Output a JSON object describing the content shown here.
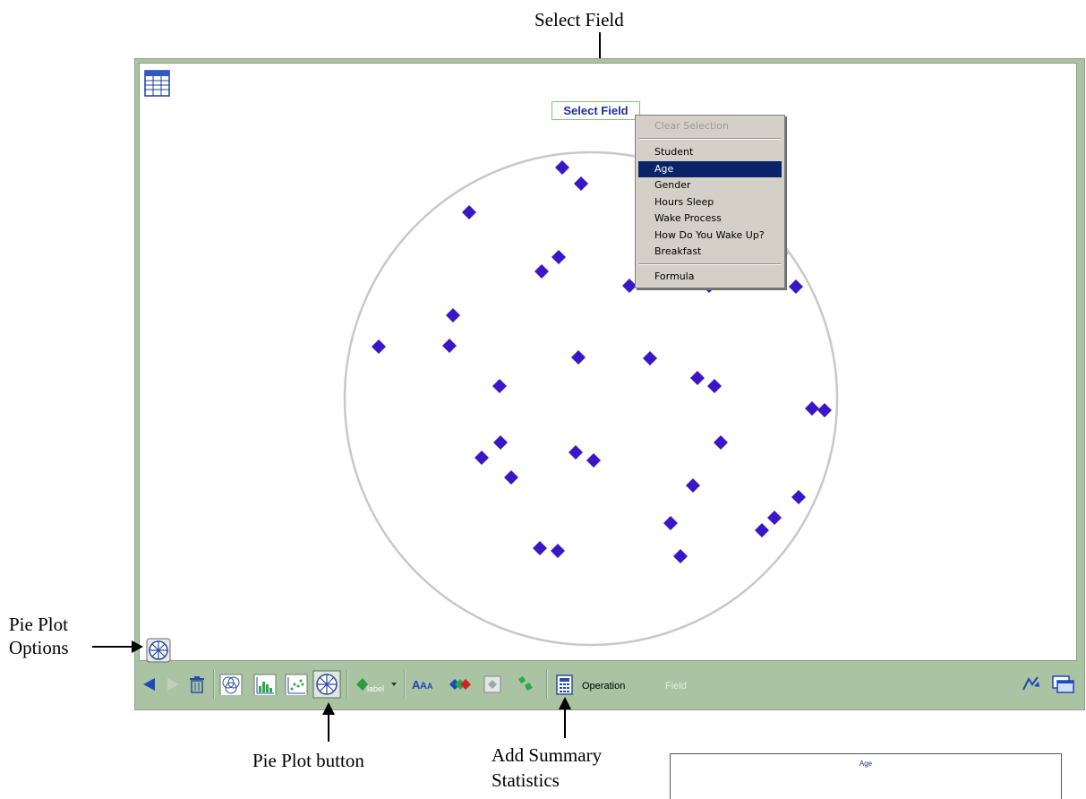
{
  "callouts": {
    "select_field": "Select Field",
    "pie_plot_options_line1": "Pie Plot",
    "pie_plot_options_line2": "Options",
    "pie_plot_button": "Pie Plot button",
    "add_summary_line1": "Add Summary",
    "add_summary_line2": "Statistics"
  },
  "plot": {
    "select_field_label": "Select Field",
    "point_color": "#3a16c8"
  },
  "menu": {
    "items": [
      {
        "label": "Clear Selection",
        "state": "disabled"
      },
      {
        "label": "Student",
        "state": "normal"
      },
      {
        "label": "Age",
        "state": "selected"
      },
      {
        "label": "Gender",
        "state": "normal"
      },
      {
        "label": "Hours Sleep",
        "state": "normal"
      },
      {
        "label": "Wake Process",
        "state": "normal"
      },
      {
        "label": "How Do You Wake Up?",
        "state": "normal"
      },
      {
        "label": "Breakfast",
        "state": "normal"
      },
      {
        "label": "Formula",
        "state": "normal"
      }
    ]
  },
  "toolbar": {
    "label_dropdown": "label",
    "operation": "Operation",
    "field": "Field",
    "bg_color": "#a9c3a3"
  },
  "bottom_panel": {
    "title": "Age"
  }
}
